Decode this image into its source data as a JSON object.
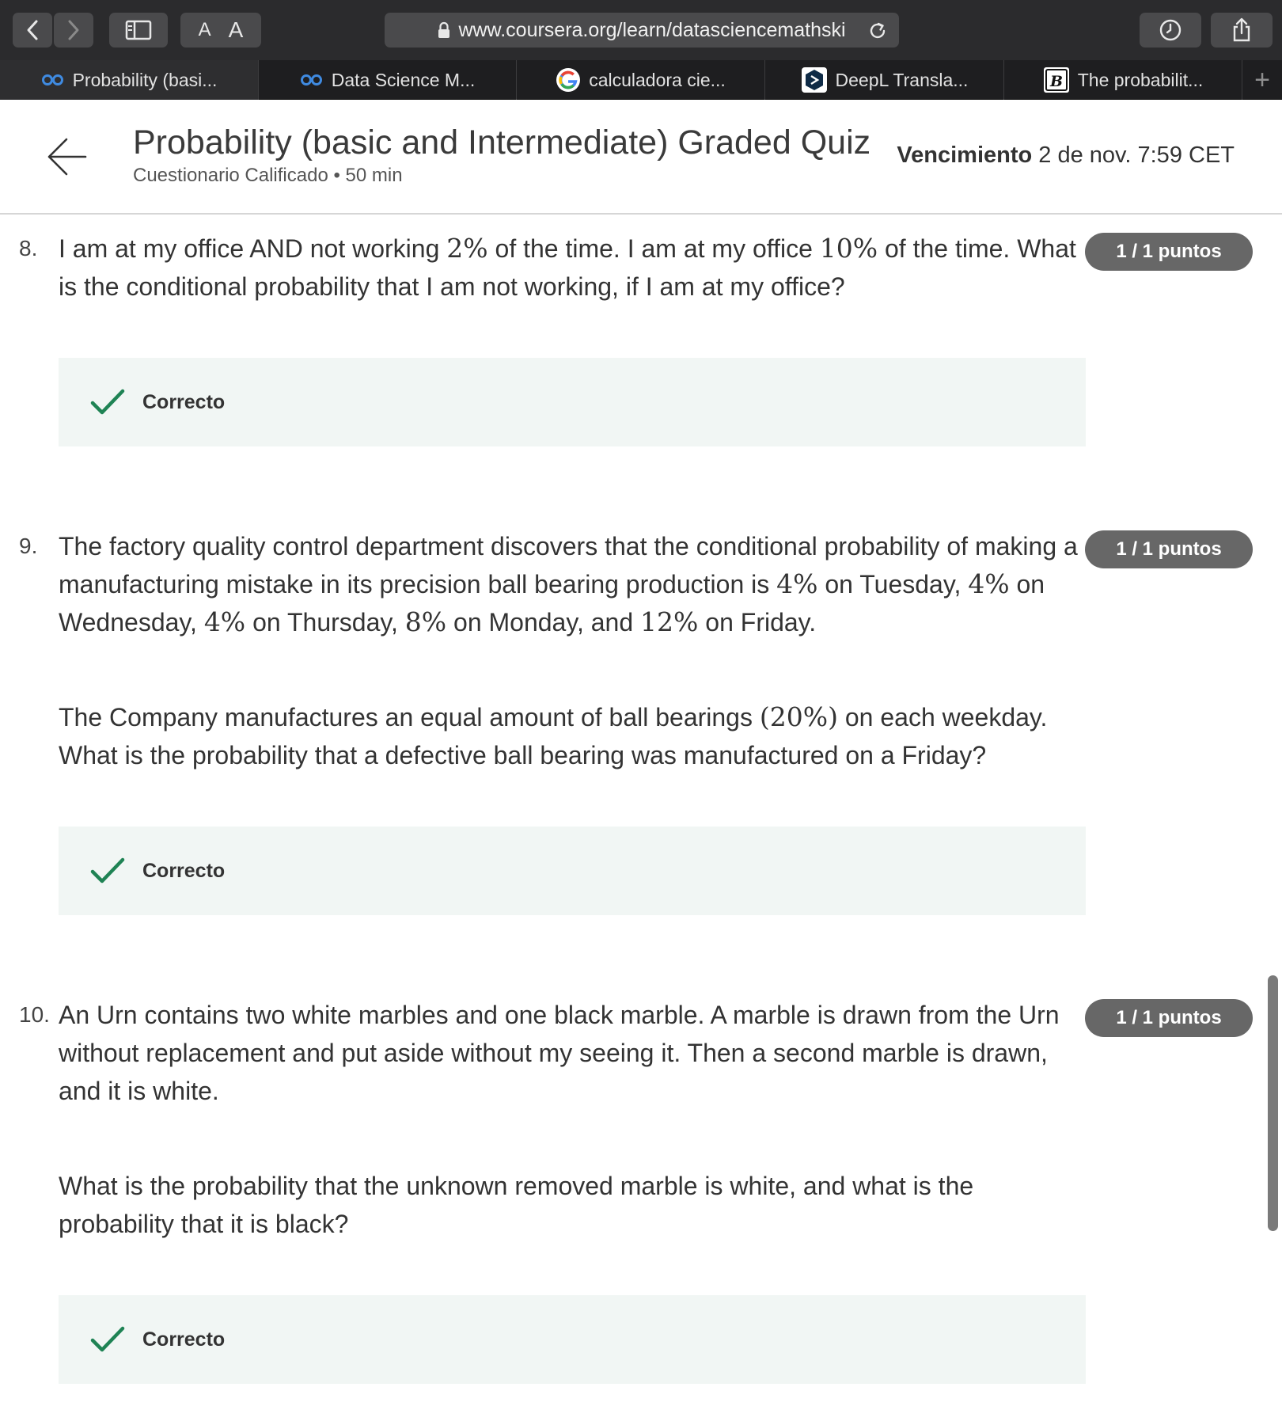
{
  "browser": {
    "url": "www.coursera.org/learn/datasciencemathski",
    "font_small": "A",
    "font_large": "A",
    "tabs": [
      {
        "label": "Probability (basi...",
        "icon": "coursera-icon"
      },
      {
        "label": "Data Science M...",
        "icon": "coursera-icon"
      },
      {
        "label": "calculadora cie...",
        "icon": "google-icon"
      },
      {
        "label": "DeepL Transla...",
        "icon": "deepl-icon"
      },
      {
        "label": "The probabilit...",
        "icon": "b-icon"
      }
    ],
    "new_tab": "+"
  },
  "header": {
    "title": "Probability (basic and Intermediate) Graded Quiz",
    "subtitle": "Cuestionario Calificado • 50 min",
    "due_label": "Vencimiento",
    "due_value": "2 de nov. 7:59 CET"
  },
  "questions": [
    {
      "number": "8.",
      "points": "1 / 1 puntos",
      "feedback": "Correcto",
      "p1": {
        "t1": "I am at my office AND not working ",
        "m1": "2%",
        "t2": " of the time. I am at my office ",
        "m2": "10%",
        "t3": " of the time. What is the conditional probability that I am not working, if I am at my office?"
      }
    },
    {
      "number": "9.",
      "points": "1 / 1 puntos",
      "feedback": "Correcto",
      "p1": {
        "t1": "The factory quality control department discovers that the conditional probability of making a manufacturing mistake in its precision ball bearing production is ",
        "m1": "4%",
        "t2": " on Tuesday, ",
        "m2": "4%",
        "t3": " on Wednesday, ",
        "m3": "4%",
        "t4": " on Thursday, ",
        "m4": "8%",
        "t5": " on Monday, and ",
        "m5": "12%",
        "t6": " on Friday."
      },
      "p2": {
        "t1": "The Company manufactures an equal amount of ball bearings ",
        "m1": "(20%)",
        "t2": " on each weekday. What is the probability that a defective ball bearing was manufactured on a Friday?"
      }
    },
    {
      "number": "10.",
      "points": "1 / 1 puntos",
      "feedback": "Correcto",
      "p1": "An Urn contains two white marbles and one black marble. A marble is drawn from the Urn without replacement and put aside without my seeing it. Then a second marble is drawn, and it is white.",
      "p2": "What is the probability that the unknown removed marble is white, and what is the probability that it is black?"
    }
  ],
  "colors": {
    "chrome_dark": "#2b2b2d",
    "tabstrip": "#1e1e20",
    "badge": "#676767",
    "feedback_bg": "#f1f6f4",
    "check_green": "#1f8354"
  }
}
